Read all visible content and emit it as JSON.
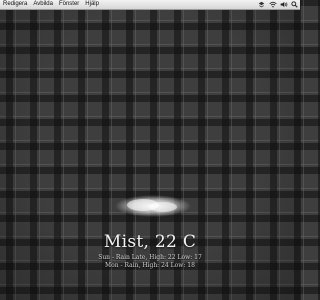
{
  "menubar": {
    "items": [
      "Redigera",
      "Avbilda",
      "Fönster",
      "Hjälp"
    ],
    "status_icons": [
      "dropbox-icon",
      "wifi-icon",
      "volume-icon",
      "spotlight-icon"
    ]
  },
  "weather": {
    "condition_icon": "cloud-icon",
    "current": "Mist, 22 C",
    "forecast": [
      "Sun - Rain Late, High: 22 Low: 17",
      "Mon - Rain, High: 24 Low: 18"
    ]
  },
  "colors": {
    "background": "#3e3e3e",
    "menubar": "#e6e6e6",
    "text": "#f3f3f3"
  }
}
